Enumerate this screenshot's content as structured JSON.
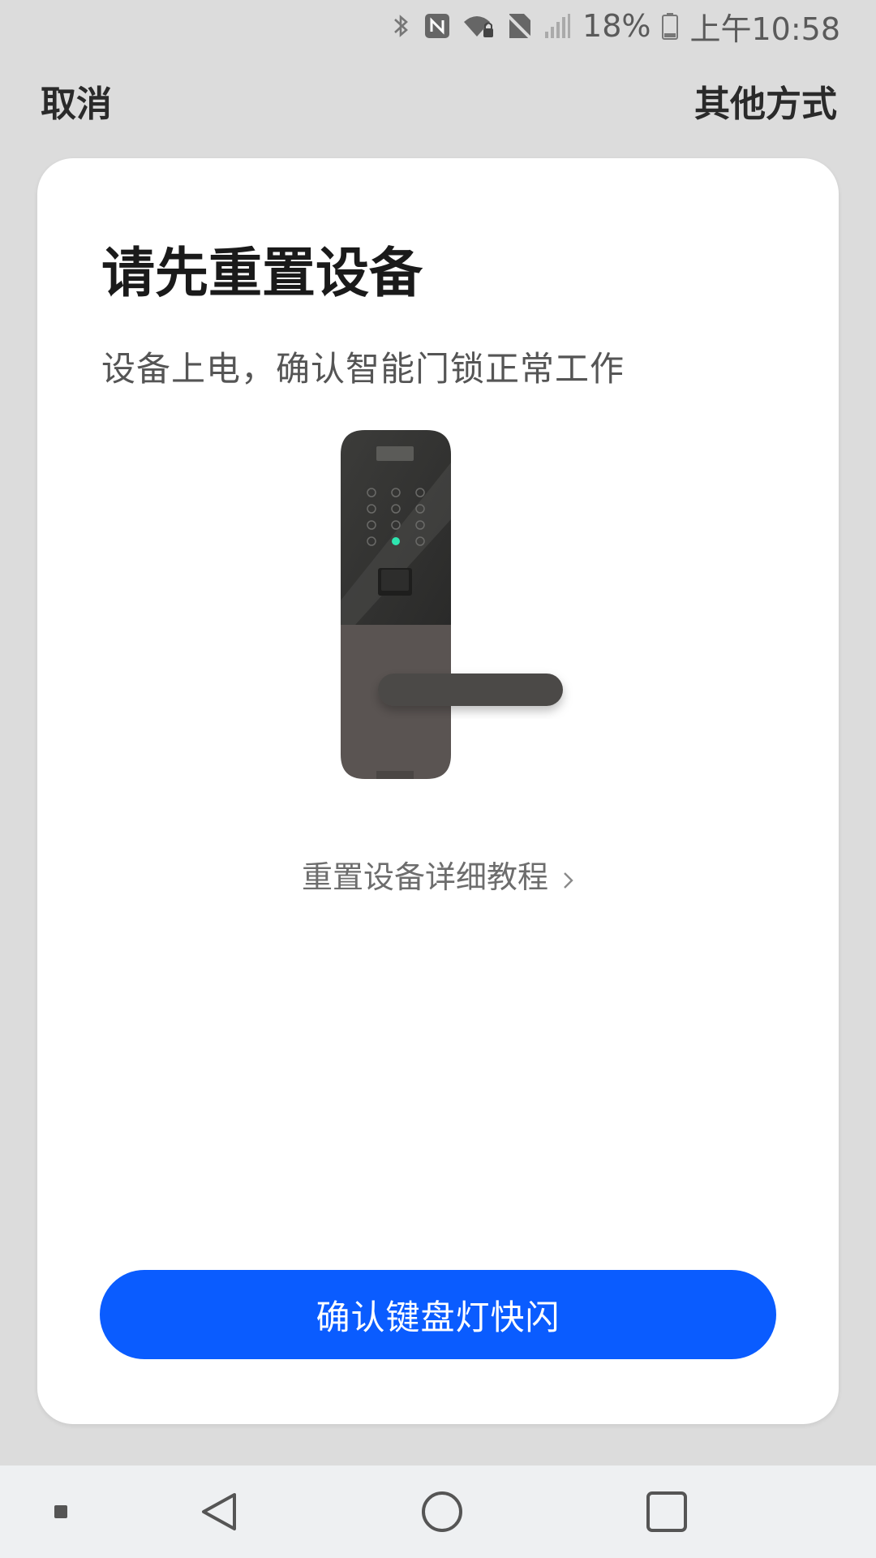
{
  "status_bar": {
    "battery_percent": "18%",
    "time": "上午10:58",
    "icons": [
      "bluetooth-icon",
      "nfc-icon",
      "wifi-lock-icon",
      "no-sim-icon",
      "signal-icon",
      "battery-icon"
    ]
  },
  "header": {
    "cancel_label": "取消",
    "other_methods_label": "其他方式"
  },
  "card": {
    "title": "请先重置设备",
    "subtitle": "设备上电，确认智能门锁正常工作",
    "tutorial_link": "重置设备详细教程",
    "confirm_button": "确认键盘灯快闪"
  },
  "colors": {
    "accent": "#0a5cff",
    "background": "#dcdcdc",
    "card": "#ffffff",
    "indicator_led": "#2ee6b0"
  },
  "nav_bar": {
    "icons": [
      "menu-dot-icon",
      "back-icon",
      "home-icon",
      "recents-icon"
    ]
  }
}
